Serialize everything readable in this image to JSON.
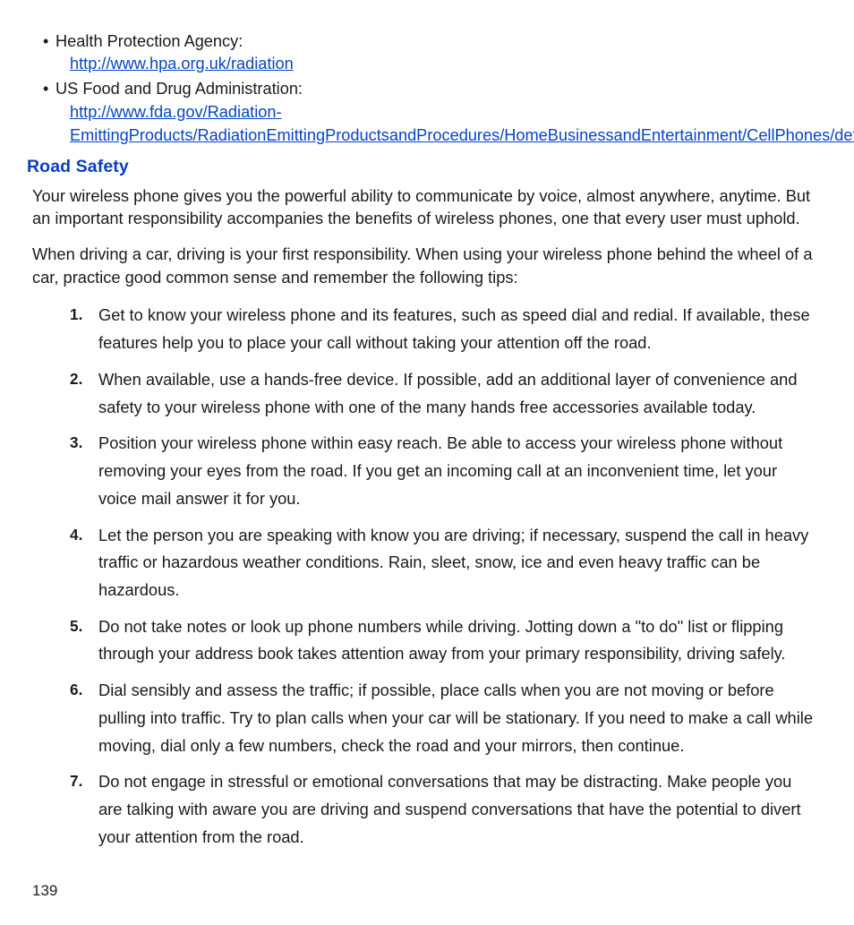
{
  "bullets": [
    {
      "label": "Health Protection Agency:",
      "link": "http://www.hpa.org.uk/radiation"
    },
    {
      "label": " US Food and Drug Administration:",
      "link": "http://www.fda.gov/Radiation-EmittingProducts/RadiationEmittingProductsandProcedures/HomeBusinessandEntertainment/CellPhones/default.htm"
    }
  ],
  "heading": "Road Safety",
  "para1": "Your wireless phone gives you the powerful ability to communicate by voice, almost anywhere, anytime. But an important responsibility accompanies the benefits of wireless phones, one that every user must uphold.",
  "para2": "When driving a car, driving is your first responsibility. When using your wireless phone behind the wheel of a car, practice good common sense and remember the following tips:",
  "tips": [
    "Get to know your wireless phone and its features, such as speed dial and redial. If available, these features help you to place your call without taking your attention off the road.",
    "When available, use a hands-free device. If possible, add an additional layer of convenience and safety to your wireless phone with one of the many hands free accessories available today.",
    "Position your wireless phone within easy reach. Be able to access your wireless phone without removing your eyes from the road. If you get an incoming call at an inconvenient time, let your voice mail answer it for you.",
    "Let the person you are speaking with know you are driving; if necessary, suspend the call in heavy traffic or hazardous weather conditions. Rain, sleet, snow, ice and even heavy traffic can be hazardous.",
    "Do not take notes or look up phone numbers while driving. Jotting down a \"to do\" list or flipping through your address book takes attention away from your primary responsibility, driving safely.",
    "Dial sensibly and assess the traffic; if possible, place calls when you are not moving or before pulling into traffic. Try to plan calls when your car will be stationary. If you need to make a call while moving, dial only a few numbers, check the road and your mirrors, then continue.",
    "Do not engage in stressful or emotional conversations that may be distracting. Make people you are talking with aware you are driving and suspend conversations that have the potential to divert your attention from the road."
  ],
  "page_number": "139"
}
